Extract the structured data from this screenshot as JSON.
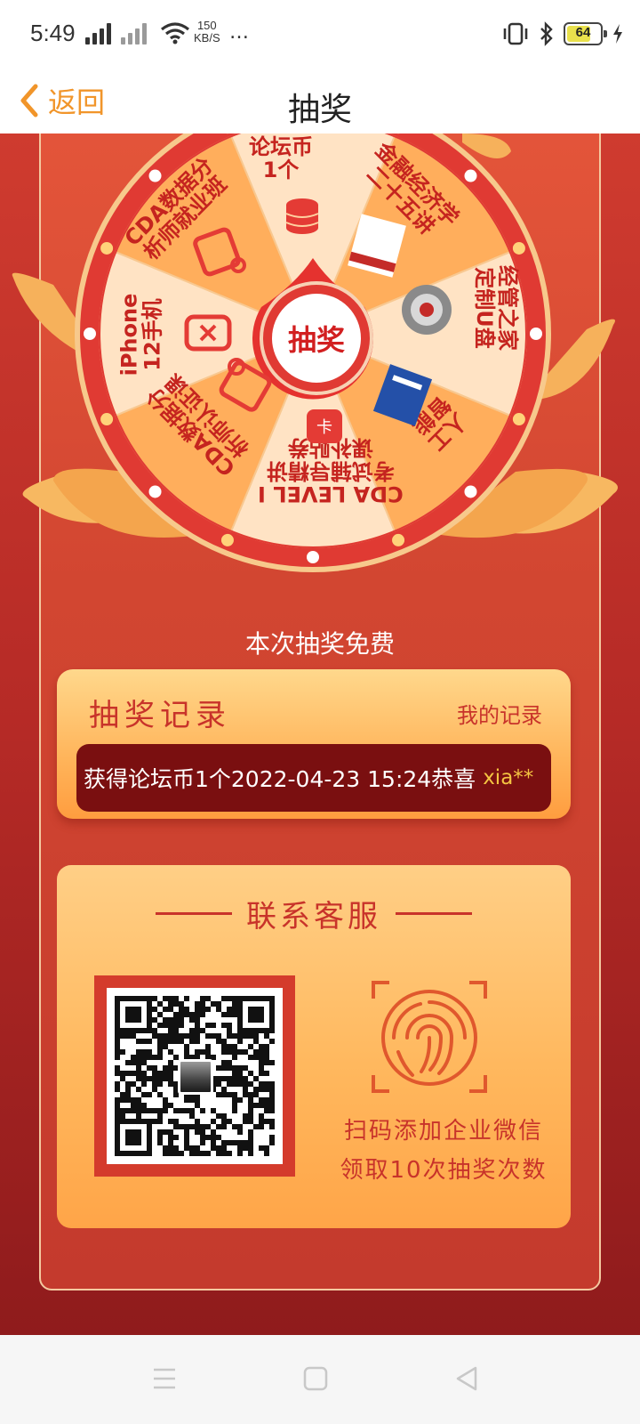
{
  "status_bar": {
    "time": "5:49",
    "net_speed_value": "150",
    "net_speed_unit": "KB/S",
    "more": "…",
    "battery": "64"
  },
  "header": {
    "back_label": "返回",
    "title": "抽奖"
  },
  "wheel": {
    "center_label": "抽奖",
    "segments": [
      {
        "label": "论坛币\n1个",
        "icon": "coins-icon"
      },
      {
        "label": "金融经济学\n二十五讲",
        "icon": "book-icon"
      },
      {
        "label": "经管之家\n定制U盘",
        "icon": "usb-drive-icon"
      },
      {
        "label": "人工\n智能",
        "icon": "blue-book-icon"
      },
      {
        "label": "CDA LEVEL I\n考试辅导精讲\n课补贴券",
        "icon": "ticket-icon"
      },
      {
        "label": "CDA数据分\n析师认证课",
        "icon": "bag-icon"
      },
      {
        "label": "iPhone\n12手机",
        "icon": "phone-icon"
      },
      {
        "label": "CDA数据分\n析师就业班",
        "icon": "briefcase-icon"
      }
    ]
  },
  "draw_status": "本次抽奖免费",
  "record": {
    "title": "抽奖记录",
    "my_records": "我的记录",
    "latest": "获得论坛币1个2022-04-23 15:24恭喜",
    "user": "xia**"
  },
  "service": {
    "title": "联系客服",
    "line1": "扫码添加企业微信",
    "line2": "领取10次抽奖次数"
  },
  "colors": {
    "accent_orange": "#f1952a",
    "wheel_red": "#e03a33",
    "record_bar": "#7a0f10"
  }
}
